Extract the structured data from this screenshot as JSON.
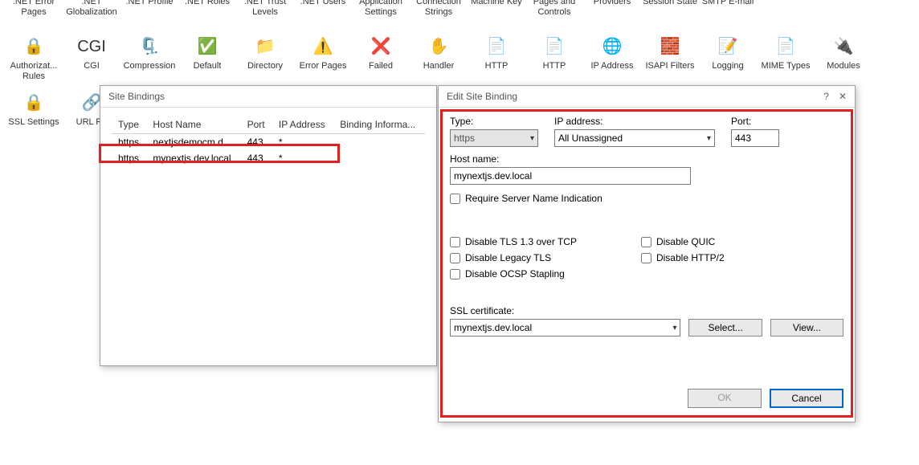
{
  "iconRow1": [
    ".NET Error Pages",
    ".NET Globalization",
    ".NET Profile",
    ".NET Roles",
    ".NET Trust Levels",
    ".NET Users",
    "Application Settings",
    "Connection Strings",
    "Machine Key",
    "Pages and Controls",
    "Providers",
    "Session State",
    "SMTP E-mail"
  ],
  "iconRow2": [
    "Authorizat... Rules",
    "CGI",
    "Compression",
    "Default",
    "Directory",
    "Error Pages",
    "Failed",
    "Handler",
    "HTTP",
    "HTTP",
    "IP Address",
    "ISAPI Filters",
    "Logging",
    "MIME Types",
    "Modules"
  ],
  "iconRow3": [
    "SSL Settings",
    "URL Re"
  ],
  "bindingsDialog": {
    "title": "Site Bindings",
    "headers": [
      "Type",
      "Host Name",
      "Port",
      "IP Address",
      "Binding Informa..."
    ],
    "rows": [
      {
        "type": "https",
        "host": "nextjsdemocm.d...",
        "port": "443",
        "ip": "*",
        "info": ""
      },
      {
        "type": "https",
        "host": "mynextjs.dev.local",
        "port": "443",
        "ip": "*",
        "info": ""
      }
    ]
  },
  "editDialog": {
    "title": "Edit Site Binding",
    "labels": {
      "type": "Type:",
      "ip": "IP address:",
      "port": "Port:",
      "host": "Host name:",
      "sni": "Require Server Name Indication",
      "tls13": "Disable TLS 1.3 over TCP",
      "quic": "Disable QUIC",
      "legacy": "Disable Legacy TLS",
      "http2": "Disable HTTP/2",
      "ocsp": "Disable OCSP Stapling",
      "sslcert": "SSL certificate:"
    },
    "values": {
      "type": "https",
      "ip": "All Unassigned",
      "port": "443",
      "host": "mynextjs.dev.local",
      "sslcert": "mynextjs.dev.local"
    },
    "buttons": {
      "select": "Select...",
      "view": "View...",
      "ok": "OK",
      "cancel": "Cancel"
    }
  }
}
